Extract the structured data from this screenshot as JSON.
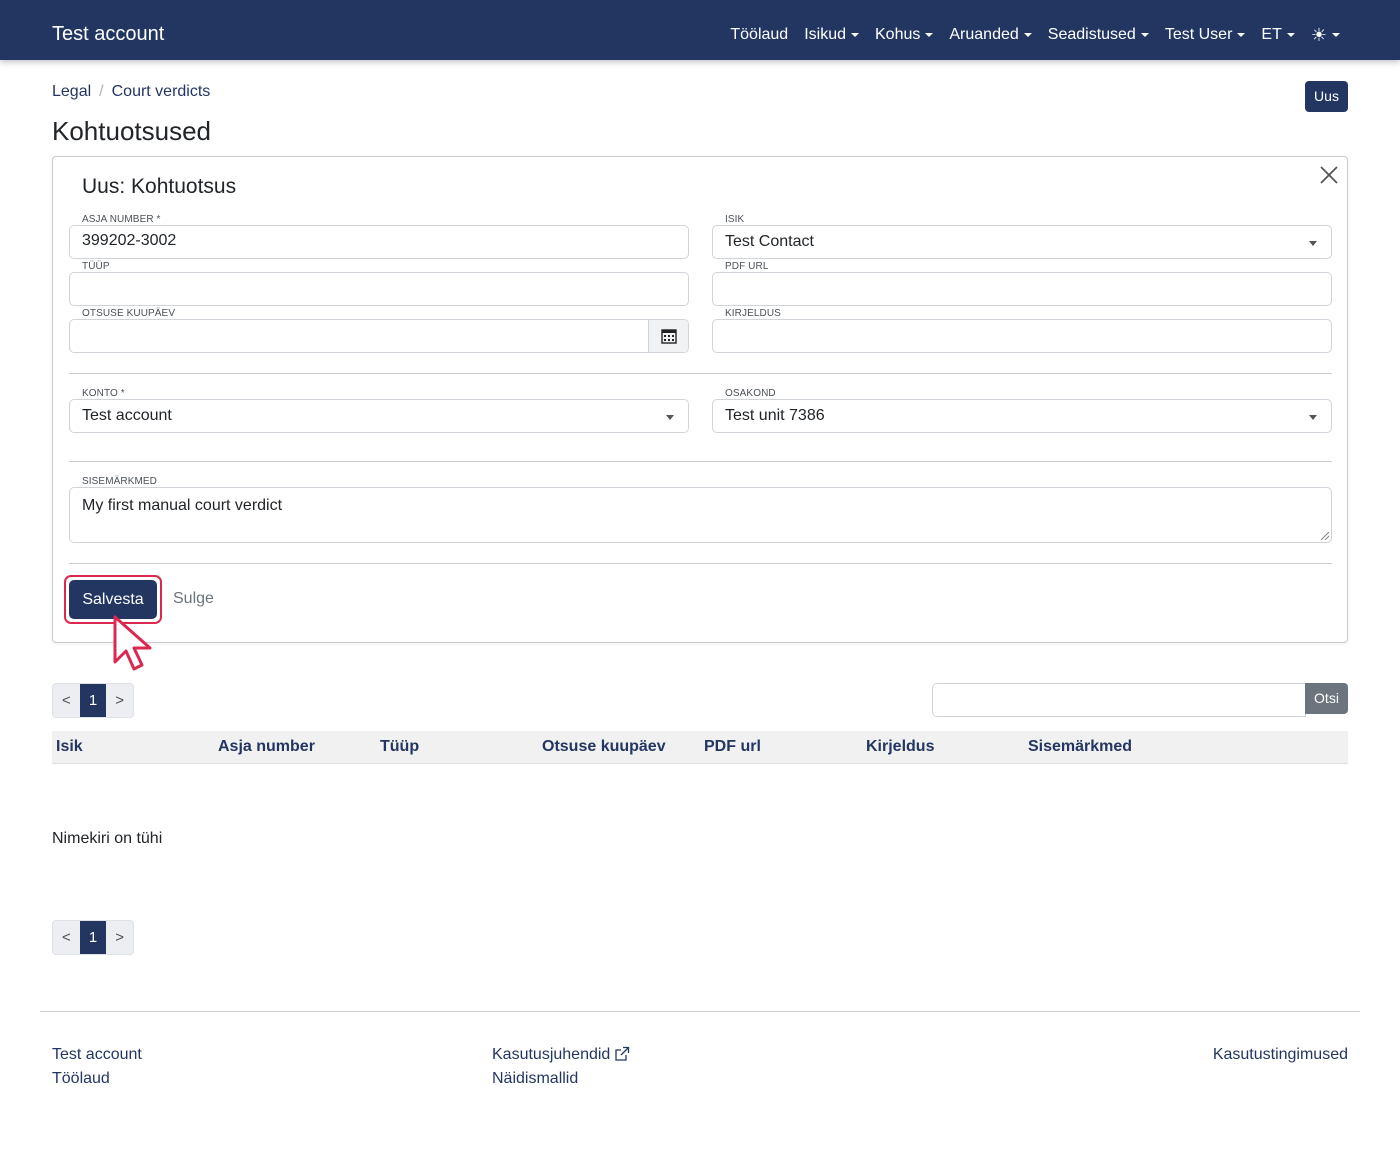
{
  "navbar": {
    "brand": "Test account",
    "items": [
      {
        "label": "Töölaud",
        "dropdown": false
      },
      {
        "label": "Isikud",
        "dropdown": true
      },
      {
        "label": "Kohus",
        "dropdown": true
      },
      {
        "label": "Aruanded",
        "dropdown": true
      },
      {
        "label": "Seadistused",
        "dropdown": true
      },
      {
        "label": "Test User",
        "dropdown": true
      },
      {
        "label": "ET",
        "dropdown": true
      }
    ],
    "theme_icon": "sun-icon"
  },
  "breadcrumb": {
    "items": [
      "Legal",
      "Court verdicts"
    ]
  },
  "new_button": "Uus",
  "page_title": "Kohtuotsused",
  "form": {
    "title": "Uus: Kohtuotsus",
    "case_number": {
      "label": "ASJA NUMBER *",
      "value": "399202-3002"
    },
    "person": {
      "label": "ISIK",
      "value": "Test Contact"
    },
    "type": {
      "label": "TÜÜP",
      "value": ""
    },
    "pdf_url": {
      "label": "PDF URL",
      "value": ""
    },
    "decision_date": {
      "label": "OTSUSE KUUPÄEV",
      "value": ""
    },
    "description": {
      "label": "KIRJELDUS",
      "value": ""
    },
    "account": {
      "label": "KONTO *",
      "value": "Test account"
    },
    "department": {
      "label": "OSAKOND",
      "value": "Test unit 7386"
    },
    "notes": {
      "label": "SISEMÄRKMED",
      "value": "My first manual court verdict"
    },
    "save": "Salvesta",
    "close": "Sulge"
  },
  "pagination": {
    "prev": "<",
    "page": "1",
    "next": ">"
  },
  "search": {
    "value": "",
    "button": "Otsi"
  },
  "table": {
    "columns": [
      "Isik",
      "Asja number",
      "Tüüp",
      "Otsuse kuupäev",
      "PDF url",
      "Kirjeldus",
      "Sisemärkmed"
    ],
    "empty_text": "Nimekiri on tühi"
  },
  "footer": {
    "col1": [
      "Test account",
      "Töölaud"
    ],
    "col2": [
      "Kasutusjuhendid",
      "Näidismallid"
    ],
    "col3": [
      "Kasutustingimused"
    ]
  },
  "colors": {
    "primary": "#233662",
    "highlight": "#dc2850",
    "secondary": "#6c757d"
  }
}
